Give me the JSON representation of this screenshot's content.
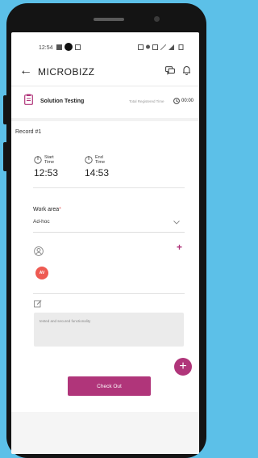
{
  "status_bar": {
    "time": "12:54"
  },
  "app": {
    "title": "MICROBIZZ"
  },
  "task": {
    "name": "Solution Testing",
    "registered_label": "Total Registered Time",
    "registered_time": "00:00"
  },
  "record": {
    "label": "Record #1",
    "start_label": "Start Time",
    "start_value": "12:53",
    "end_label": "End Time",
    "end_value": "14:53"
  },
  "work_area": {
    "label": "Work area",
    "required_mark": "*",
    "value": "Ad-hoc"
  },
  "assignee": {
    "avatar_initials": "AV"
  },
  "notes": {
    "text": "tested and secured functionality"
  },
  "actions": {
    "checkout_label": "Check Out"
  },
  "colors": {
    "accent": "#b0357a",
    "avatar": "#ee5a52",
    "background": "#5cc0e8"
  },
  "icons": {
    "back": "arrow-left-icon",
    "chat": "chat-icon",
    "bell": "bell-icon",
    "task": "clipboard-icon",
    "clock": "clock-icon",
    "stopwatch": "stopwatch-icon",
    "chevron": "chevron-down-icon",
    "user": "user-circle-icon",
    "plus": "plus-icon",
    "edit": "edit-icon"
  }
}
